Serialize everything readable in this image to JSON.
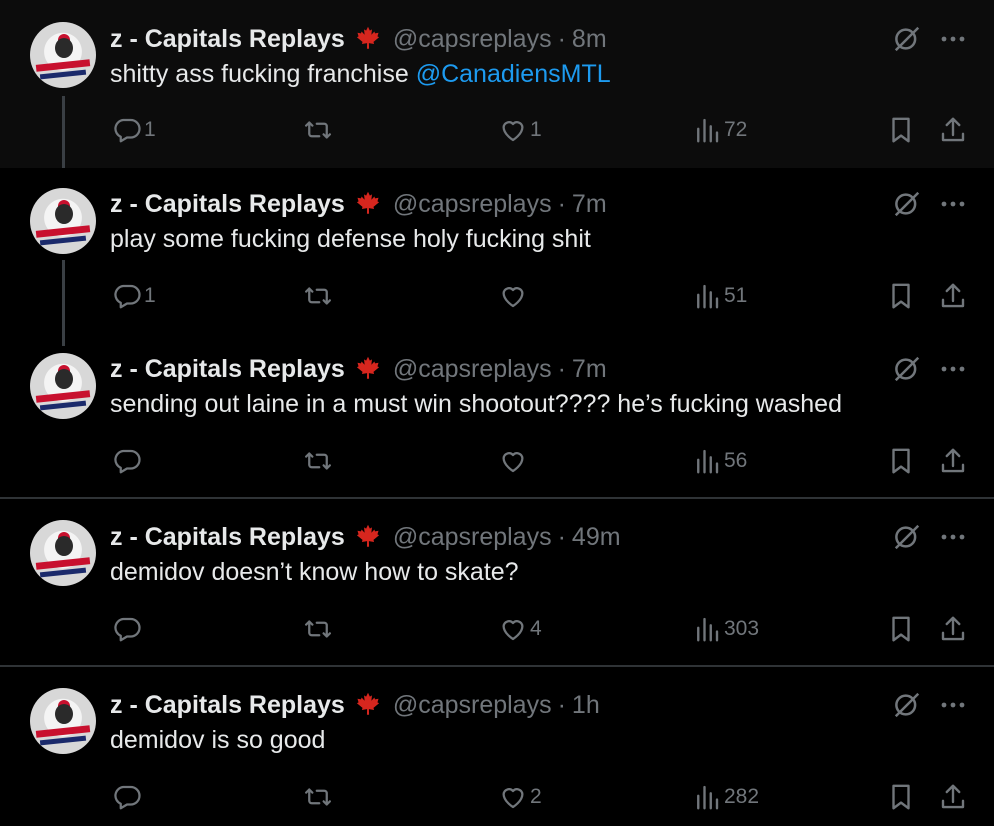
{
  "posts": [
    {
      "author": "z - Capitals Replays",
      "handle": "@capsreplays",
      "separator": "·",
      "time": "8m",
      "text": "shitty ass fucking franchise ",
      "mention": "@CanadiensMTL",
      "replies": "1",
      "reposts": "",
      "likes": "1",
      "views": "72"
    },
    {
      "author": "z - Capitals Replays",
      "handle": "@capsreplays",
      "separator": "·",
      "time": "7m",
      "text": "play some fucking defense holy fucking shit",
      "mention": "",
      "replies": "1",
      "reposts": "",
      "likes": "",
      "views": "51"
    },
    {
      "author": "z - Capitals Replays",
      "handle": "@capsreplays",
      "separator": "·",
      "time": "7m",
      "text": "sending out laine in a must win shootout???? he’s fucking washed",
      "mention": "",
      "replies": "",
      "reposts": "",
      "likes": "",
      "views": "56"
    },
    {
      "author": "z - Capitals Replays",
      "handle": "@capsreplays",
      "separator": "·",
      "time": "49m",
      "text": "demidov doesn’t know how to skate?",
      "mention": "",
      "replies": "",
      "reposts": "",
      "likes": "4",
      "views": "303"
    },
    {
      "author": "z - Capitals Replays",
      "handle": "@capsreplays",
      "separator": "·",
      "time": "1h",
      "text": "demidov is so good",
      "mention": "",
      "replies": "",
      "reposts": "",
      "likes": "2",
      "views": "282"
    }
  ],
  "icons": {
    "flag": "maple-leaf-icon",
    "grok": "grok-icon",
    "more": "more-icon",
    "reply": "reply-icon",
    "repost": "repost-icon",
    "like": "like-icon",
    "views": "views-icon",
    "bookmark": "bookmark-icon",
    "share": "share-icon"
  },
  "colors": {
    "background": "#000000",
    "text": "#e7e9ea",
    "muted": "#71767b",
    "link": "#1d9bf0",
    "leaf": "#d7261e",
    "divider": "#2f3336"
  }
}
